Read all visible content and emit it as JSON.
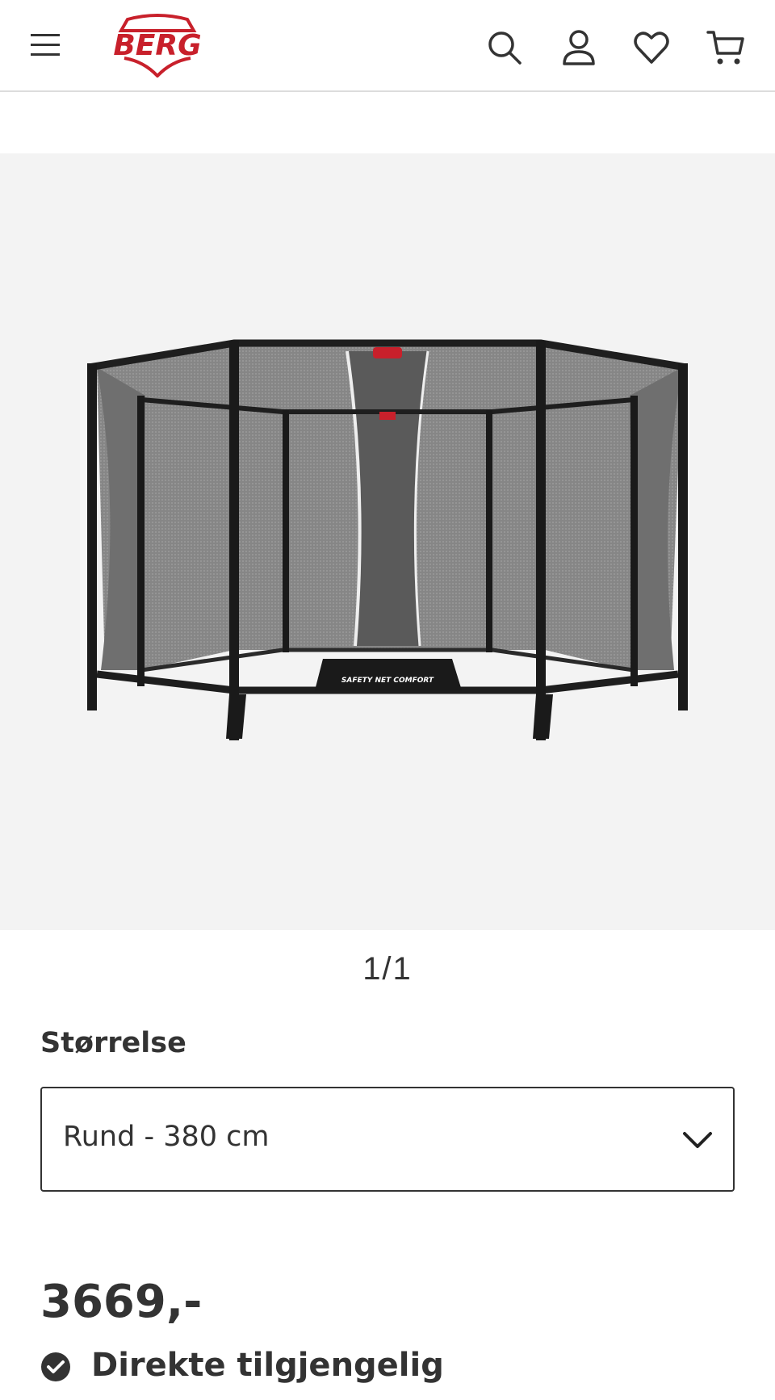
{
  "header": {
    "logo_text": "BERG",
    "brand_color": "#c8202b",
    "icons": [
      "menu-icon",
      "search-icon",
      "user-icon",
      "heart-icon",
      "cart-icon"
    ]
  },
  "gallery": {
    "counter": "1/1",
    "product_image": "trampoline-safety-net",
    "net_label": "SAFETY NET COMFORT",
    "background_color": "#f3f3f3"
  },
  "size": {
    "label": "Størrelse",
    "selected": "Rund - 380 cm"
  },
  "price": "3669,-",
  "availability": {
    "text": "Direkte tilgjengelig",
    "icon": "check-circle-icon"
  }
}
